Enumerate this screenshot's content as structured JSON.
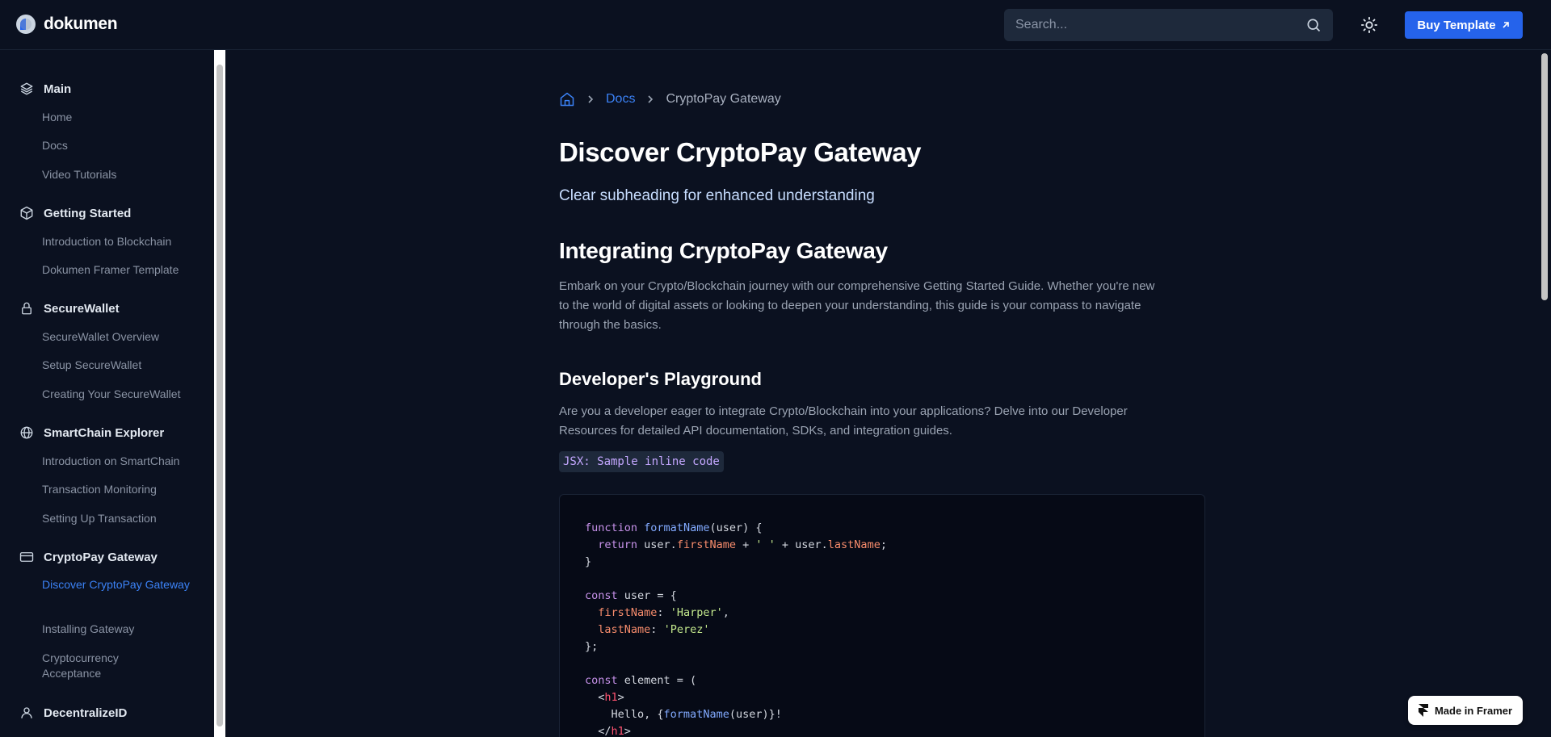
{
  "header": {
    "logo_text": "dokumen",
    "search_placeholder": "Search...",
    "buy_label": "Buy Template"
  },
  "sidebar": {
    "sections": [
      {
        "title": "Main",
        "icon": "layers-icon",
        "items": [
          "Home",
          "Docs",
          "Video Tutorials"
        ]
      },
      {
        "title": "Getting Started",
        "icon": "cube-icon",
        "items": [
          "Introduction to Blockchain",
          "Dokumen Framer Template"
        ]
      },
      {
        "title": "SecureWallet",
        "icon": "lock-icon",
        "items": [
          "SecureWallet Overview",
          "Setup SecureWallet",
          "Creating Your SecureWallet"
        ]
      },
      {
        "title": "SmartChain Explorer",
        "icon": "globe-icon",
        "items": [
          "Introduction on SmartChain",
          "Transaction Monitoring",
          "Setting Up Transaction"
        ]
      },
      {
        "title": "CryptoPay Gateway",
        "icon": "credit-card-icon",
        "items": [
          "Discover CryptoPay Gateway",
          "Installing Gateway",
          "Cryptocurrency Acceptance"
        ]
      },
      {
        "title": "DecentralizeID",
        "icon": "user-icon",
        "items": []
      }
    ],
    "active_item": "Discover CryptoPay Gateway"
  },
  "breadcrumb": {
    "link": "Docs",
    "current": "CryptoPay Gateway"
  },
  "content": {
    "title": "Discover CryptoPay Gateway",
    "subheading": "Clear subheading for enhanced understanding",
    "h2": "Integrating CryptoPay Gateway",
    "para1": [
      "Embark on your Crypto/Blockchain journey with our comprehensive Getting Started Guide. Whether you're new",
      "to the world of digital assets or looking to deepen your understanding, this guide is your compass to navigate",
      "through the basics."
    ],
    "h3": "Developer's Playground",
    "para2": [
      "Are you a developer eager to integrate Crypto/Blockchain into your applications? Delve into our Developer",
      "Resources for detailed API documentation, SDKs, and integration guides."
    ],
    "inline_code": "JSX: Sample inline code"
  },
  "code": {
    "lines": [
      "function formatName(user) {",
      "  return user.firstName + ' ' + user.lastName;",
      "}",
      "",
      "const user = {",
      "  firstName: 'Harper',",
      "  lastName: 'Perez'",
      "};",
      "",
      "const element = (",
      "  <h1>",
      "    Hello, {formatName(user)}!",
      "  </h1>"
    ]
  },
  "badge": {
    "label": "Made in Framer"
  },
  "colors": {
    "accent": "#2563eb",
    "link": "#3b82f6",
    "background": "#0b1120"
  }
}
